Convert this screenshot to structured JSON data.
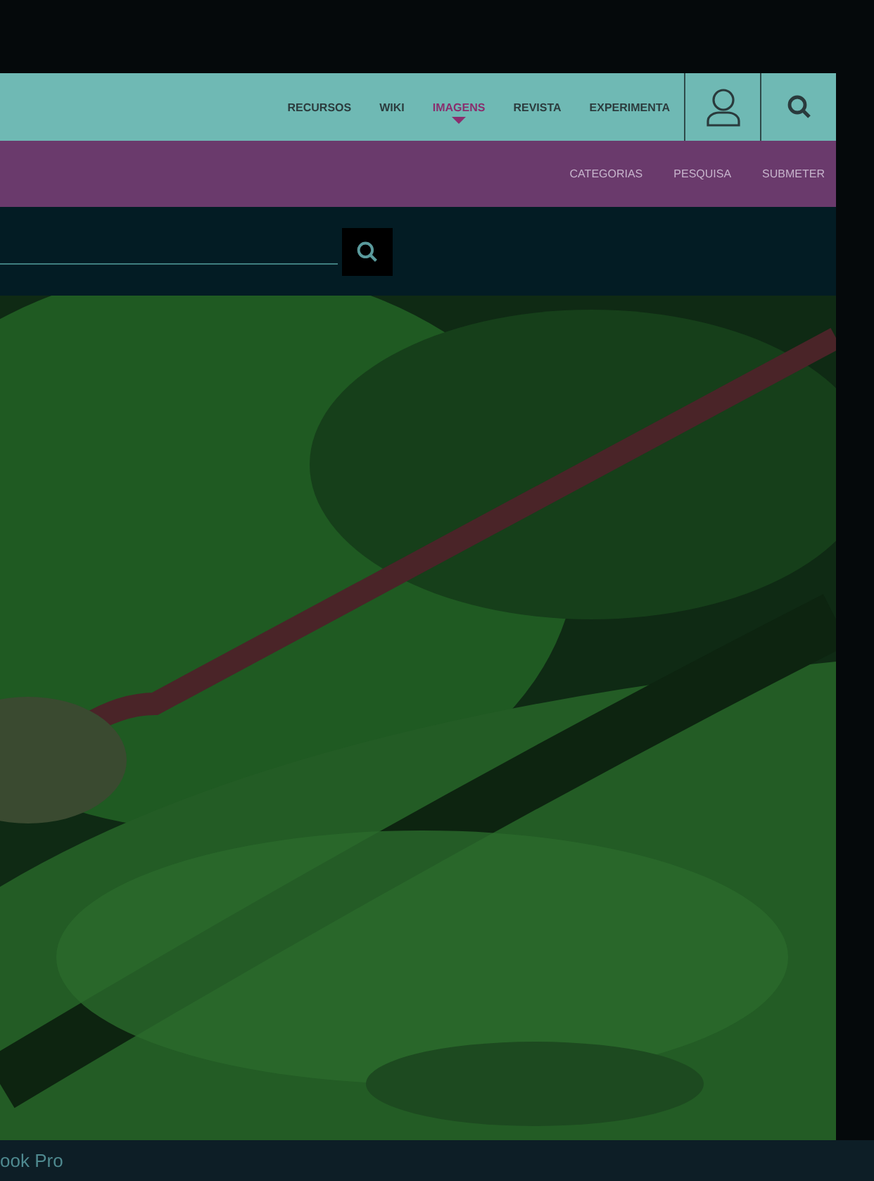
{
  "nav": {
    "items": [
      {
        "label": "RECURSOS",
        "selected": false
      },
      {
        "label": "WIKI",
        "selected": false
      },
      {
        "label": "IMAGENS",
        "selected": true
      },
      {
        "label": "REVISTA",
        "selected": false
      },
      {
        "label": "EXPERIMENTA",
        "selected": false
      }
    ]
  },
  "subnav": {
    "items": [
      "CATEGORIAS",
      "PESQUISA",
      "SUBMETER"
    ]
  },
  "device_label": "ook Pro"
}
